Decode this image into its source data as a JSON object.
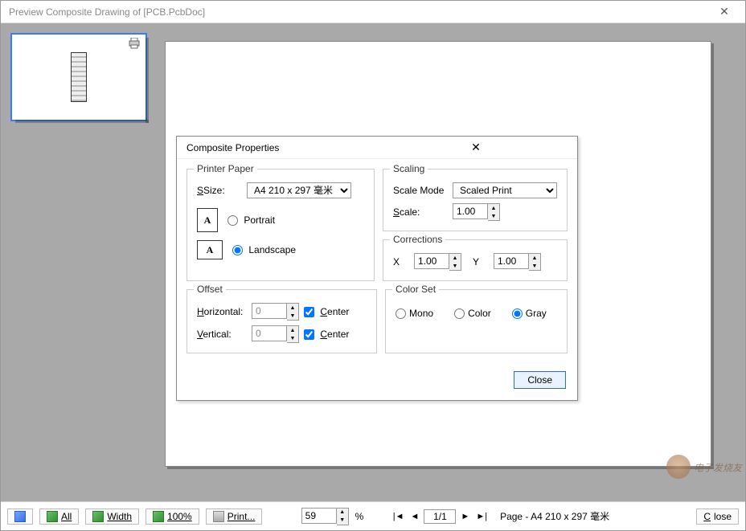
{
  "window": {
    "title": "Preview Composite Drawing of [PCB.PcbDoc]"
  },
  "dialog": {
    "title": "Composite Properties",
    "groups": {
      "printer_paper": {
        "title": "Printer Paper",
        "size_label": "Size:",
        "size_value": "A4 210 x 297 毫米",
        "portrait_label": "Portrait",
        "landscape_label": "Landscape",
        "orientation": "landscape"
      },
      "scaling": {
        "title": "Scaling",
        "mode_label": "Scale Mode",
        "mode_value": "Scaled Print",
        "scale_label": "Scale:",
        "scale_value": "1.00"
      },
      "corrections": {
        "title": "Corrections",
        "x_label": "X",
        "x_value": "1.00",
        "y_label": "Y",
        "y_value": "1.00"
      },
      "offset": {
        "title": "Offset",
        "h_label": "Horizontal:",
        "h_value": "0",
        "v_label": "Vertical:",
        "v_value": "0",
        "center_label": "Center",
        "h_center": true,
        "v_center": true
      },
      "color_set": {
        "title": "Color Set",
        "mono_label": "Mono",
        "color_label": "Color",
        "gray_label": "Gray",
        "value": "gray"
      }
    },
    "close_label": "Close"
  },
  "toolbar": {
    "all_label": "All",
    "width_label": "Width",
    "hundred_label": "100%",
    "print_label": "Print...",
    "zoom_value": "59",
    "zoom_pct": "%",
    "page_current": "1/1",
    "page_info": "Page - A4 210 x 297 毫米",
    "close_label": "Close"
  },
  "watermark": "电子发烧友"
}
